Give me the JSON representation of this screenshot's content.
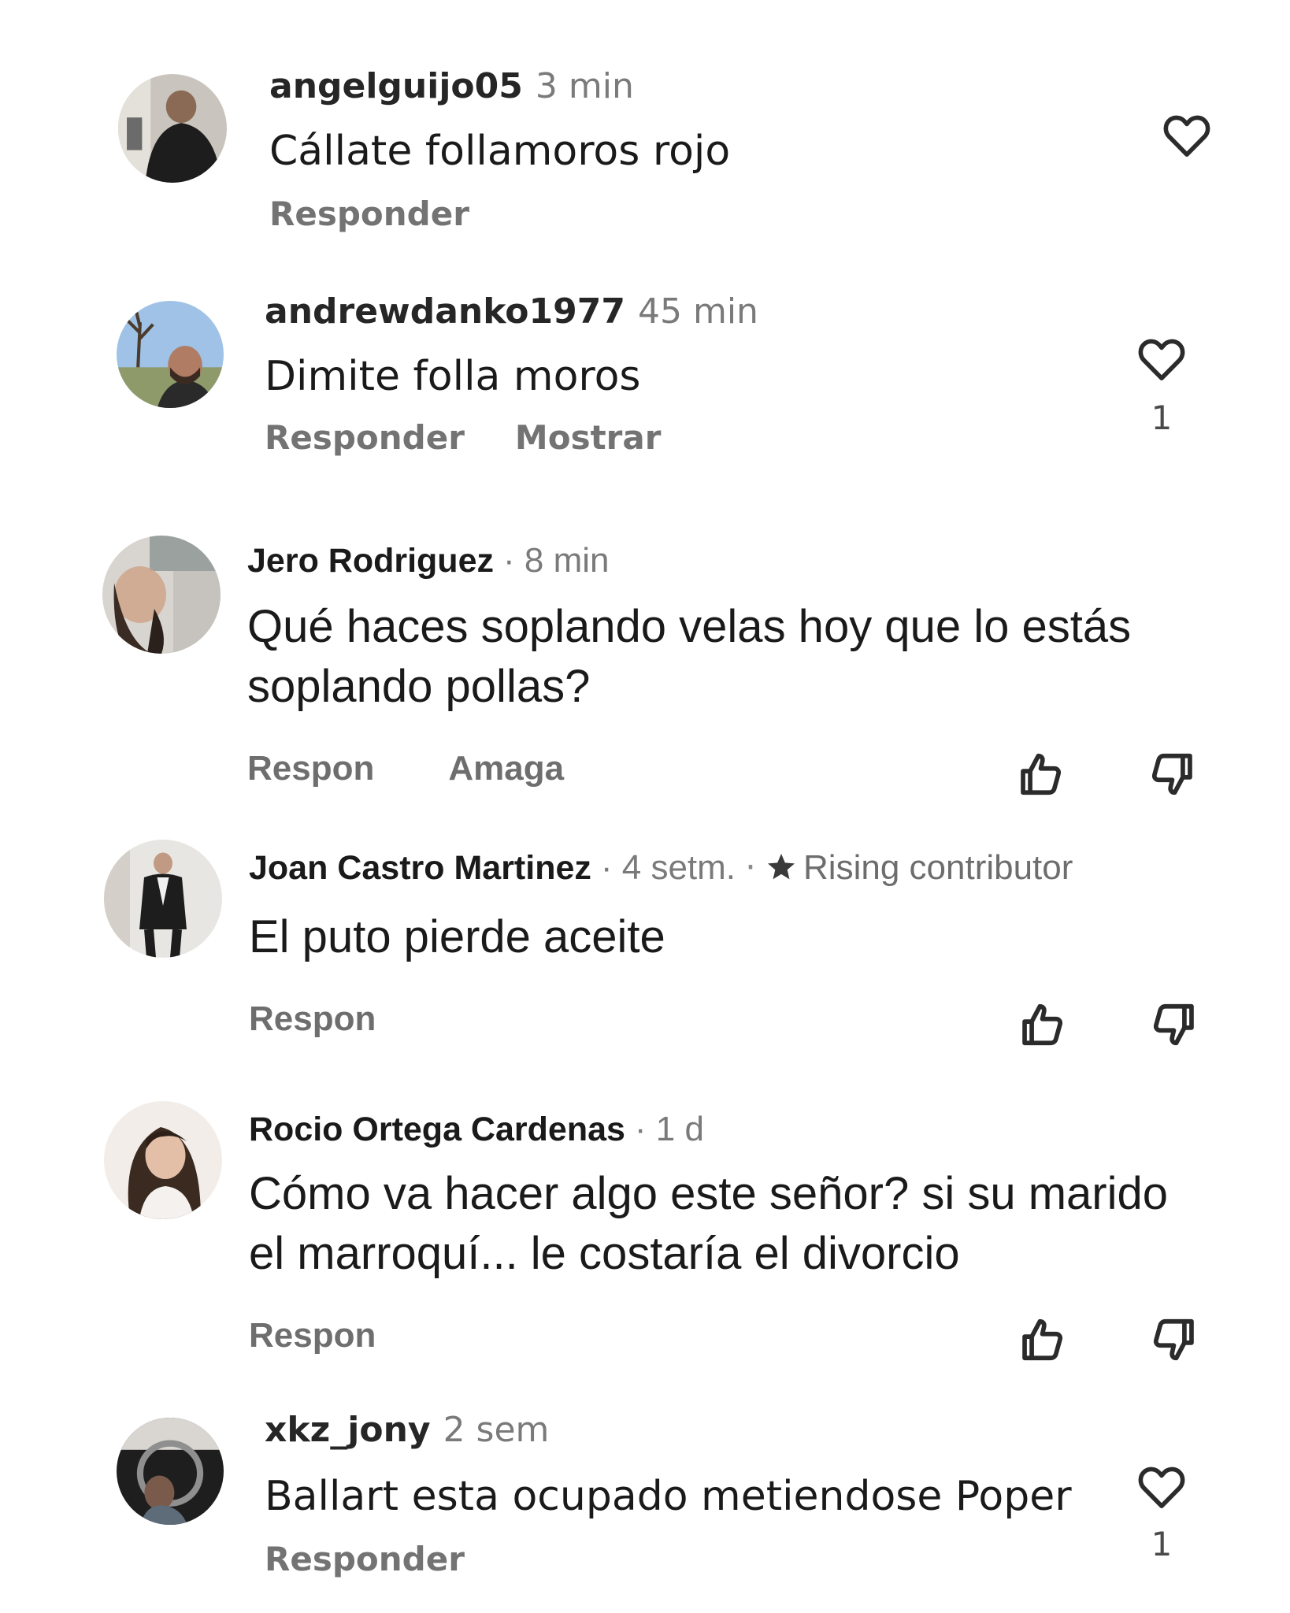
{
  "comments": [
    {
      "username": "angelguijo05",
      "time": "3 min",
      "text": [
        "Cállate follamoros rojo"
      ],
      "actions": [
        "Responder"
      ],
      "likes": ""
    },
    {
      "username": "andrewdanko1977",
      "time": "45 min",
      "text": [
        "Dimite folla moros"
      ],
      "actions": [
        "Responder",
        "Mostrar"
      ],
      "likes": "1"
    },
    {
      "username": "Jero Rodriguez",
      "time": "· 8 min",
      "text": [
        "Qué haces soplando velas hoy que lo estás",
        "soplando pollas?"
      ],
      "actions": [
        "Respon",
        "Amaga"
      ]
    },
    {
      "username": "Joan Castro Martinez",
      "time": "· 4 setm.",
      "badge_sep": "·",
      "badge": "Rising contributor",
      "text": [
        "El puto pierde aceite"
      ],
      "actions": [
        "Respon"
      ]
    },
    {
      "username": "Rocio Ortega Cardenas",
      "time": "· 1 d",
      "text": [
        "Cómo va hacer algo este señor? si su marido",
        "el marroquí... le costaría el divorcio"
      ],
      "actions": [
        "Respon"
      ]
    },
    {
      "username": "xkz_jony",
      "time": "2 sem",
      "text": [
        "Ballart esta ocupado metiendose Poper"
      ],
      "actions": [
        "Responder"
      ],
      "likes": "1"
    }
  ],
  "icons": {
    "heart": "heart-outline-icon",
    "thumbs_up": "thumbs-up-icon",
    "thumbs_down": "thumbs-down-icon",
    "star": "star-icon"
  }
}
